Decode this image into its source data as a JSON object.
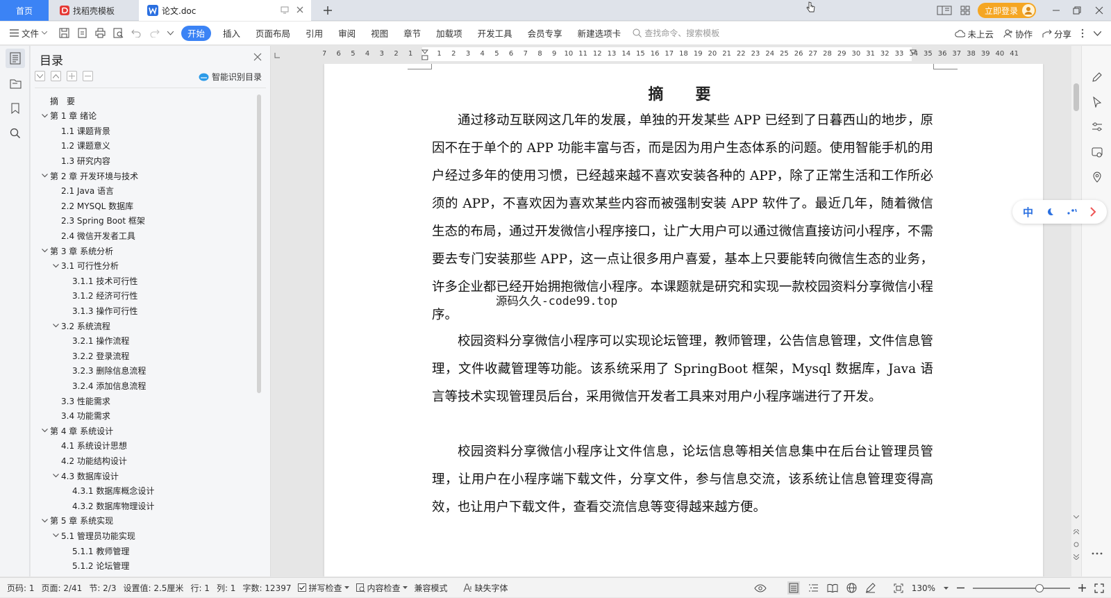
{
  "titlebar": {
    "tab_home": "首页",
    "tab_find": "找稻壳模板",
    "tab_doc": "论文.doc",
    "login": "立即登录"
  },
  "ribbon": {
    "file": "文件",
    "tabs": [
      "开始",
      "插入",
      "页面布局",
      "引用",
      "审阅",
      "视图",
      "章节",
      "加载项",
      "开发工具",
      "会员专享",
      "新建选项卡"
    ],
    "search_placeholder": "查找命令、搜索模板",
    "cloud": "未上云",
    "collab": "协作",
    "share": "分享"
  },
  "toc": {
    "title": "目录",
    "smart": "智能识别目录",
    "items": [
      {
        "text": "摘　要",
        "level": 0,
        "chev": false
      },
      {
        "text": "第 1 章 绪论",
        "level": 0,
        "chev": true
      },
      {
        "text": "1.1 课题背景",
        "level": 1,
        "chev": false
      },
      {
        "text": "1.2 课题意义",
        "level": 1,
        "chev": false
      },
      {
        "text": "1.3 研究内容",
        "level": 1,
        "chev": false
      },
      {
        "text": "第 2 章 开发环境与技术",
        "level": 0,
        "chev": true
      },
      {
        "text": "2.1 Java 语言",
        "level": 1,
        "chev": false
      },
      {
        "text": "2.2 MYSQL 数据库",
        "level": 1,
        "chev": false
      },
      {
        "text": "2.3 Spring Boot 框架",
        "level": 1,
        "chev": false
      },
      {
        "text": "2.4 微信开发者工具",
        "level": 1,
        "chev": false
      },
      {
        "text": "第 3 章 系统分析",
        "level": 0,
        "chev": true
      },
      {
        "text": "3.1 可行性分析",
        "level": 1,
        "chev": true
      },
      {
        "text": "3.1.1 技术可行性",
        "level": 2,
        "chev": false
      },
      {
        "text": "3.1.2 经济可行性",
        "level": 2,
        "chev": false
      },
      {
        "text": "3.1.3 操作可行性",
        "level": 2,
        "chev": false
      },
      {
        "text": "3.2 系统流程",
        "level": 1,
        "chev": true
      },
      {
        "text": "3.2.1 操作流程",
        "level": 2,
        "chev": false
      },
      {
        "text": "3.2.2 登录流程",
        "level": 2,
        "chev": false
      },
      {
        "text": "3.2.3 删除信息流程",
        "level": 2,
        "chev": false
      },
      {
        "text": "3.2.4 添加信息流程",
        "level": 2,
        "chev": false
      },
      {
        "text": "3.3 性能需求",
        "level": 1,
        "chev": false
      },
      {
        "text": "3.4 功能需求",
        "level": 1,
        "chev": false
      },
      {
        "text": "第 4 章 系统设计",
        "level": 0,
        "chev": true
      },
      {
        "text": "4.1 系统设计思想",
        "level": 1,
        "chev": false
      },
      {
        "text": "4.2 功能结构设计",
        "level": 1,
        "chev": false
      },
      {
        "text": "4.3 数据库设计",
        "level": 1,
        "chev": true
      },
      {
        "text": "4.3.1 数据库概念设计",
        "level": 2,
        "chev": false
      },
      {
        "text": "4.3.2 数据库物理设计",
        "level": 2,
        "chev": false
      },
      {
        "text": "第 5 章 系统实现",
        "level": 0,
        "chev": true
      },
      {
        "text": "5.1 管理员功能实现",
        "level": 1,
        "chev": true
      },
      {
        "text": "5.1.1 教师管理",
        "level": 2,
        "chev": false
      },
      {
        "text": "5.1.2 论坛管理",
        "level": 2,
        "chev": false
      }
    ]
  },
  "ruler": {
    "labels": [
      "7",
      "6",
      "5",
      "4",
      "3",
      "2",
      "1",
      "",
      "1",
      "2",
      "3",
      "4",
      "5",
      "6",
      "7",
      "8",
      "9",
      "10",
      "11",
      "12",
      "13",
      "14",
      "15",
      "16",
      "17",
      "18",
      "19",
      "20",
      "21",
      "22",
      "23",
      "24",
      "25",
      "26",
      "27",
      "28",
      "29",
      "30",
      "31",
      "32",
      "33",
      "34",
      "35",
      "36",
      "37",
      "38",
      "39",
      "40",
      "41"
    ]
  },
  "document": {
    "title": "摘　要",
    "paragraphs": [
      "通过移动互联网这几年的发展，单独的开发某些 APP 已经到了日暮西山的地步，原因不在于单个的 APP 功能丰富与否，而是因为用户生态体系的问题。使用智能手机的用户经过多年的使用习惯，已经越来越不喜欢安装各种的 APP，除了正常生活和工作所必须的 APP，不喜欢因为喜欢某些内容而被强制安装 APP 软件了。最近几年，随着微信生态的布局，通过开发微信小程序接口，让广大用户可以通过微信直接访问小程序，不需要去专门安装那些 APP，这一点让很多用户喜爱，基本上只要能转向微信生态的业务，许多企业都已经开始拥抱微信小程序。本课题就是研究和实现一款校园资料分享微信小程序。",
      "校园资料分享微信小程序可以实现论坛管理，教师管理，公告信息管理，文件信息管理，文件收藏管理等功能。该系统采用了 SpringBoot 框架，Mysql 数据库，Java 语言等技术实现管理员后台，采用微信开发者工具来对用户小程序端进行了开发。",
      "校园资料分享微信小程序让文件信息，论坛信息等相关信息集中在后台让管理员管理，让用户在小程序端下载文件，分享文件，参与信息交流，该系统让信息管理变得高效，也让用户下载文件，查看交流信息等变得越来越方便。"
    ],
    "watermark": "源码久久-code99.top"
  },
  "ime": {
    "lang": "中"
  },
  "status": {
    "page_no": "页码: 1",
    "page": "页面: 2/41",
    "section": "节: 2/3",
    "setting": "设置值: 2.5厘米",
    "row": "行: 1",
    "col": "列: 1",
    "words": "字数: 12397",
    "spell": "拼写检查",
    "content": "内容检查",
    "compat": "兼容模式",
    "missing_font": "缺失字体",
    "zoom": "130%"
  },
  "colors": {
    "accent": "#3b83f5",
    "login": "#f5a623",
    "doc_icon": "#2a6fe0",
    "find_icon": "#e53935"
  }
}
